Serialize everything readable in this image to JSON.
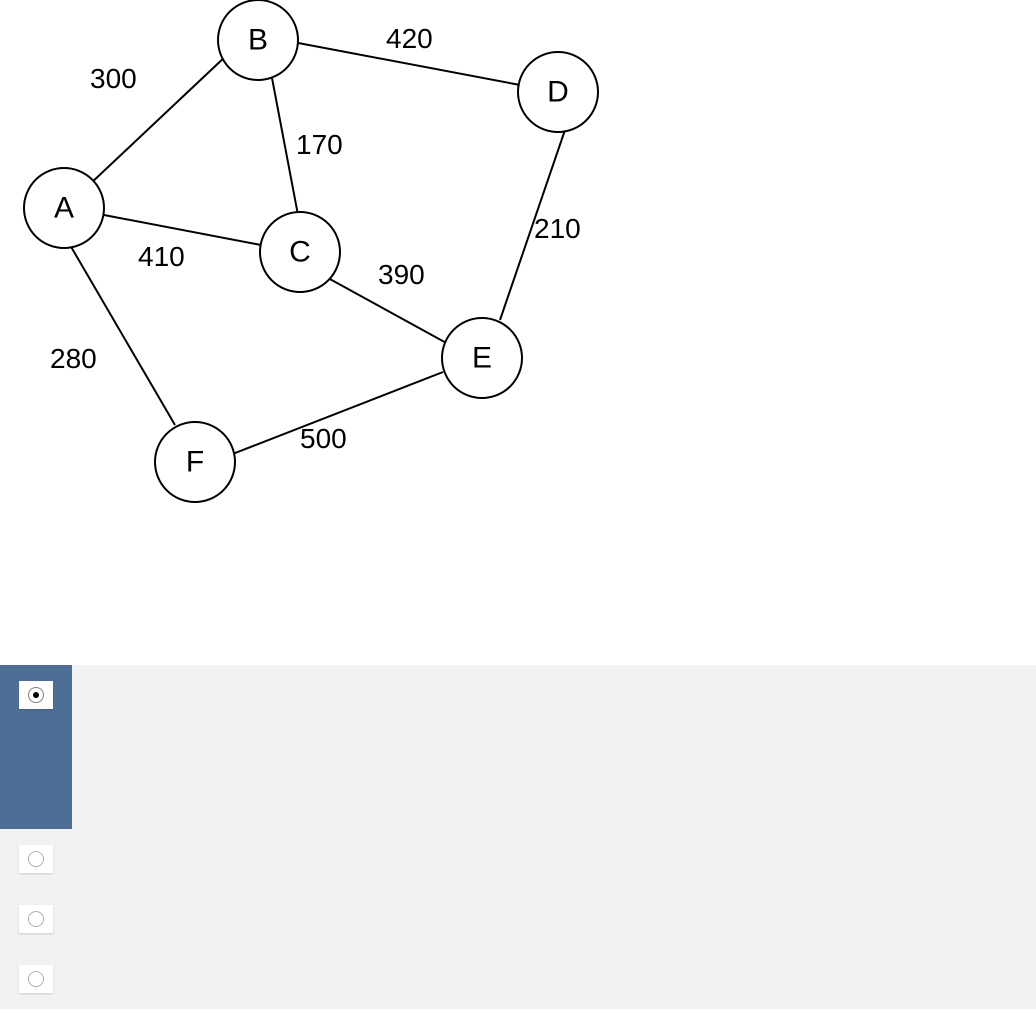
{
  "graph": {
    "nodes": {
      "A": "A",
      "B": "B",
      "C": "C",
      "D": "D",
      "E": "E",
      "F": "F"
    },
    "edge_labels": {
      "AB": "300",
      "BD": "420",
      "BC": "170",
      "AC": "410",
      "DE": "210",
      "CE": "390",
      "AF": "280",
      "EF": "500"
    }
  },
  "options": [
    {
      "id": "opt1",
      "selected": true
    },
    {
      "id": "opt2",
      "selected": false
    },
    {
      "id": "opt3",
      "selected": false
    },
    {
      "id": "opt4",
      "selected": false
    }
  ],
  "colors": {
    "selected_bg": "#4d6f96",
    "panel_bg": "#f2f2f2"
  }
}
